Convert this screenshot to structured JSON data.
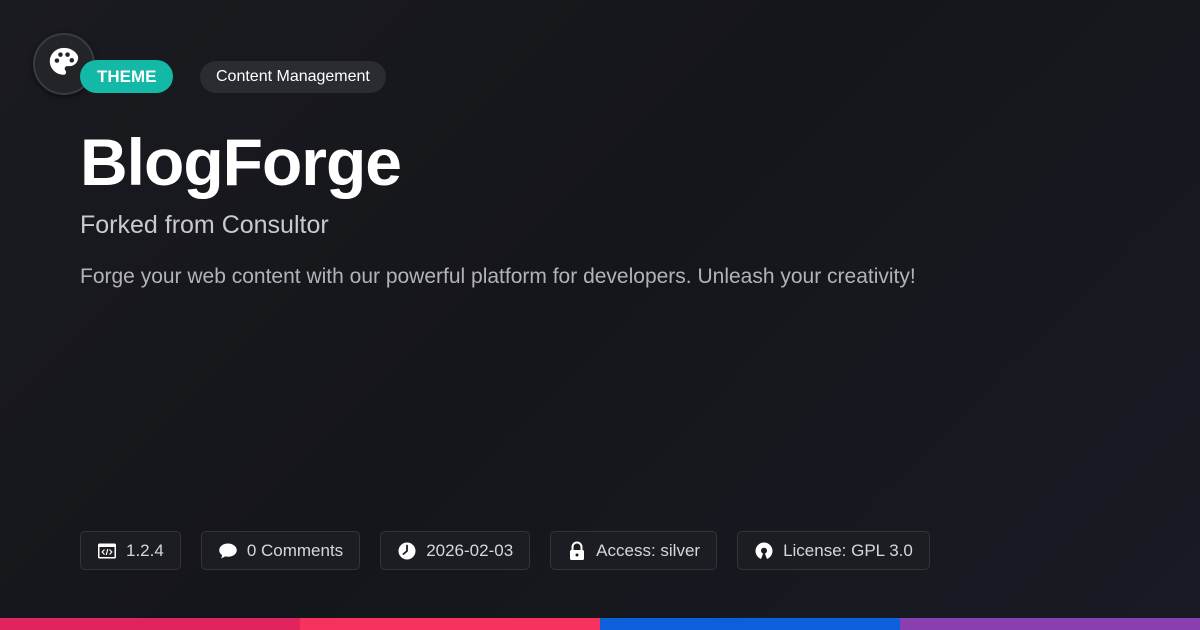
{
  "logo": {
    "icon": "palette-icon"
  },
  "badges": {
    "type": "THEME",
    "category": "Content Management"
  },
  "title": "BlogForge",
  "subtitle": "Forked from Consultor",
  "description": "Forge your web content with our powerful platform for developers. Unleash your creativity!",
  "meta": {
    "version": "1.2.4",
    "comments": "0 Comments",
    "date": "2026-02-03",
    "access": "Access: silver",
    "license": "License: GPL 3.0"
  },
  "colors": {
    "accent": "#14b8a6",
    "stripe": [
      "#e0245e",
      "#f7325f",
      "#0d5fdb",
      "#8a3fb0"
    ]
  }
}
